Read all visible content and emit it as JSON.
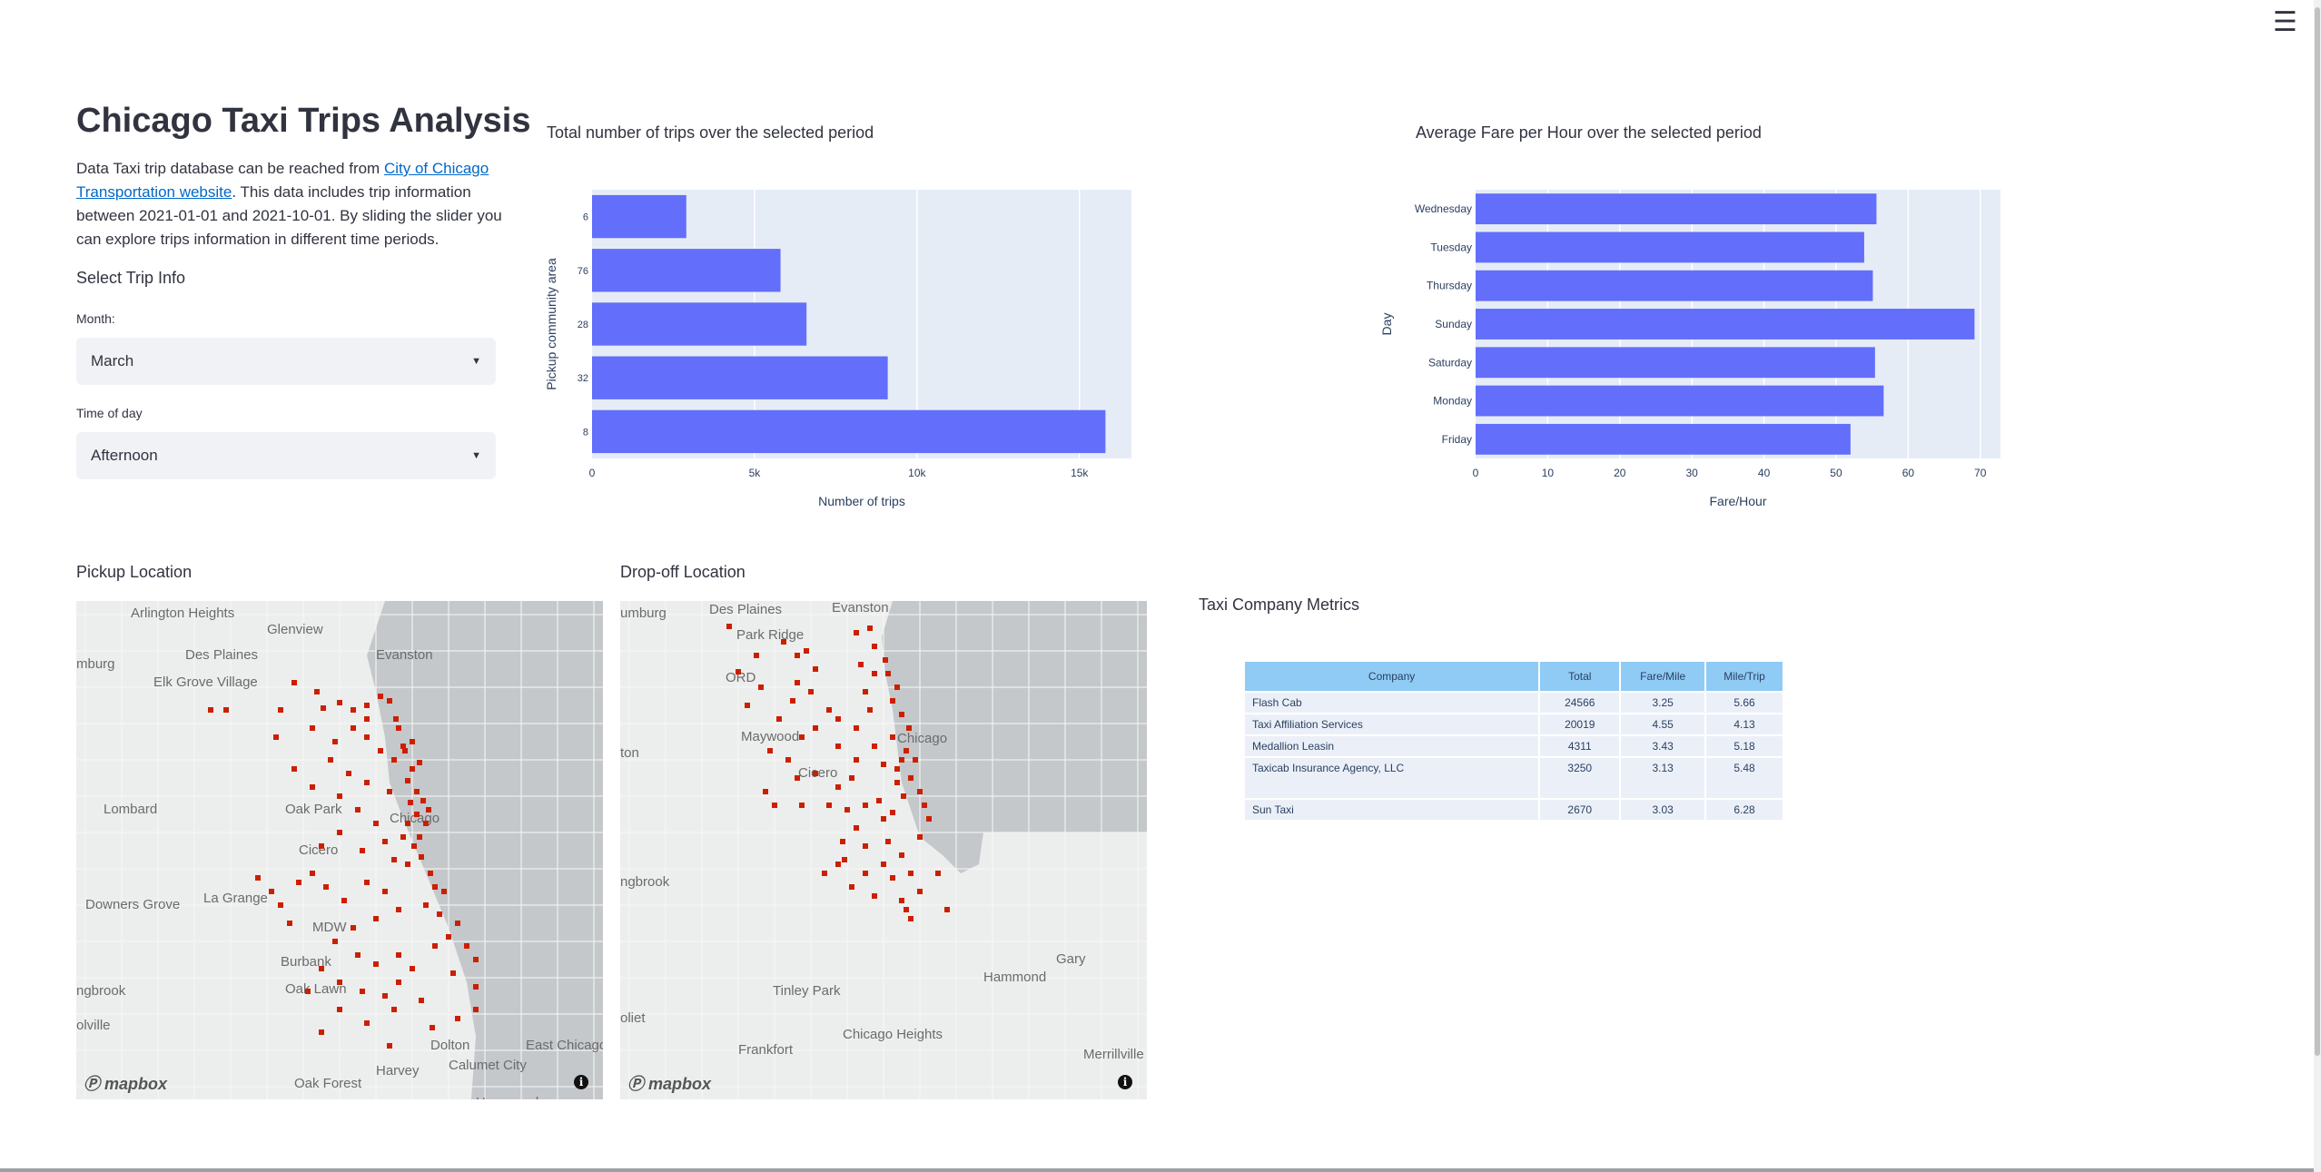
{
  "header": {
    "menu_icon": "hamburger-icon"
  },
  "sidebar": {
    "title": "Chicago Taxi Trips Analysis",
    "desc_prefix": "Data Taxi trip database can be reached from ",
    "desc_link": "City of Chicago Transportation website",
    "desc_suffix": ". This data includes trip information between 2021-01-01 and 2021-10-01. By sliding the slider you can explore trips information in different time periods.",
    "select_heading": "Select Trip Info",
    "month_label": "Month:",
    "month_value": "March",
    "time_label": "Time of day",
    "time_value": "Afternoon"
  },
  "charts_titles": {
    "trips": "Total number of trips over the selected period",
    "fare": "Average Fare per Hour over the selected period"
  },
  "chart_data": [
    {
      "type": "bar",
      "orientation": "horizontal",
      "categories": [
        "6",
        "76",
        "28",
        "32",
        "8"
      ],
      "values": [
        2900,
        5800,
        6600,
        9100,
        15800
      ],
      "xlabel": "Number of trips",
      "ylabel": "Pickup community area",
      "xlim": [
        0,
        16600
      ],
      "xticks": [
        {
          "value": 0,
          "label": "0"
        },
        {
          "value": 5000,
          "label": "5k"
        },
        {
          "value": 10000,
          "label": "10k"
        },
        {
          "value": 15000,
          "label": "15k"
        }
      ],
      "color": "#636efa",
      "grid": true
    },
    {
      "type": "bar",
      "orientation": "horizontal",
      "categories": [
        "Wednesday",
        "Tuesday",
        "Thursday",
        "Sunday",
        "Saturday",
        "Monday",
        "Friday"
      ],
      "values": [
        55.6,
        53.9,
        55.1,
        69.2,
        55.4,
        56.6,
        52.0
      ],
      "xlabel": "Fare/Hour",
      "ylabel": "Day",
      "xlim": [
        0,
        72.8
      ],
      "xticks": [
        {
          "value": 0,
          "label": "0"
        },
        {
          "value": 10,
          "label": "10"
        },
        {
          "value": 20,
          "label": "20"
        },
        {
          "value": 30,
          "label": "30"
        },
        {
          "value": 40,
          "label": "40"
        },
        {
          "value": 50,
          "label": "50"
        },
        {
          "value": 60,
          "label": "60"
        },
        {
          "value": 70,
          "label": "70"
        }
      ],
      "color": "#636efa",
      "grid": true
    }
  ],
  "maps": {
    "pickup": {
      "title": "Pickup Location",
      "attribution": "mapbox",
      "labels": [
        "Arlington Heights",
        "Glenview",
        "Des Plaines",
        "Evanston",
        "Elk Grove Village",
        "mburg",
        "Lombard",
        "Oak Park",
        "Chicago",
        "Cicero",
        "Downers Grove",
        "La Grange",
        "MDW",
        "Burbank",
        "Oak Lawn",
        "ngbrook",
        "Dolton",
        "East Chicago",
        "Oak Forest",
        "Harvey",
        "Calumet City",
        "Hammond",
        "olville"
      ]
    },
    "dropoff": {
      "title": "Drop-off Location",
      "attribution": "mapbox",
      "labels": [
        "umburg",
        "Des Plaines",
        "Evanston",
        "Park Ridge",
        "ORD",
        "Maywood",
        "Chicago",
        "Cicero",
        "ton",
        "ngbrook",
        "Hammond",
        "Gary",
        "Tinley Park",
        "Chicago Heights",
        "oliet",
        "Frankfort",
        "Merrillville"
      ]
    }
  },
  "metrics": {
    "title": "Taxi Company Metrics",
    "columns": [
      "Company",
      "Total",
      "Fare/Mile",
      "Mile/Trip"
    ],
    "rows": [
      [
        "Flash Cab",
        "24566",
        "3.25",
        "5.66"
      ],
      [
        "Taxi Affiliation Services",
        "20019",
        "4.55",
        "4.13"
      ],
      [
        "Medallion Leasin",
        "4311",
        "3.43",
        "5.18"
      ],
      [
        "Taxicab Insurance Agency, LLC",
        "3250",
        "3.13",
        "5.48"
      ],
      [
        "Sun Taxi",
        "2670",
        "3.03",
        "6.28"
      ]
    ]
  },
  "colors": {
    "bar": "#636efa",
    "plot_bg": "#e5ecf6",
    "dot": "#cc1f00",
    "table_header": "#8fcbf5",
    "table_cell": "#ebf0f8",
    "water": "#c4c8cb"
  }
}
